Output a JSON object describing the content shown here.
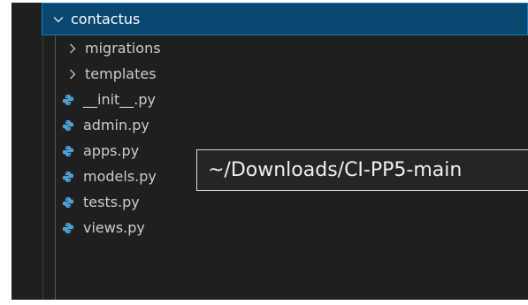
{
  "explorer": {
    "root_folder": {
      "label": "contactus",
      "icon": "chevron-down-icon",
      "expanded": true
    },
    "items": [
      {
        "label": "migrations",
        "type": "folder",
        "icon": "chevron-right-icon"
      },
      {
        "label": "templates",
        "type": "folder",
        "icon": "chevron-right-icon"
      },
      {
        "label": "__init__.py",
        "type": "file",
        "icon": "python-icon"
      },
      {
        "label": "admin.py",
        "type": "file",
        "icon": "python-icon"
      },
      {
        "label": "apps.py",
        "type": "file",
        "icon": "python-icon"
      },
      {
        "label": "models.py",
        "type": "file",
        "icon": "python-icon"
      },
      {
        "label": "tests.py",
        "type": "file",
        "icon": "python-icon"
      },
      {
        "label": "views.py",
        "type": "file",
        "icon": "python-icon"
      }
    ]
  },
  "tooltip": {
    "text": "~/Downloads/CI-PP5-main"
  },
  "colors": {
    "panel_background": "#1f1f1f",
    "selection_background": "#094771",
    "selection_border": "#1a78c2",
    "text": "#cccccc",
    "python_icon": "#4e9fd6"
  }
}
